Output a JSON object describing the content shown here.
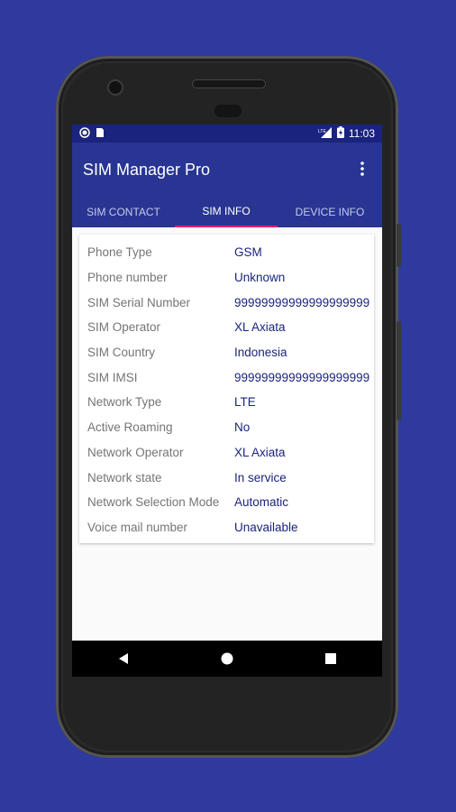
{
  "status_bar": {
    "time": "11:03",
    "left_icons": [
      "record-icon",
      "sim-card-icon"
    ],
    "right_icons": [
      "lte-signal-icon",
      "battery-icon"
    ]
  },
  "app_bar": {
    "title": "SIM Manager Pro",
    "menu_icon": "more-vert-icon"
  },
  "tabs": [
    {
      "label": "SIM CONTACT",
      "active": false
    },
    {
      "label": "SIM INFO",
      "active": true
    },
    {
      "label": "DEVICE INFO",
      "active": false
    }
  ],
  "sim_info": [
    {
      "label": "Phone Type",
      "value": "GSM"
    },
    {
      "label": "Phone number",
      "value": "Unknown"
    },
    {
      "label": "SIM Serial Number",
      "value": "99999999999999999999"
    },
    {
      "label": "SIM Operator",
      "value": "XL Axiata"
    },
    {
      "label": "SIM Country",
      "value": "Indonesia"
    },
    {
      "label": "SIM IMSI",
      "value": "99999999999999999999"
    },
    {
      "label": "Network Type",
      "value": "LTE"
    },
    {
      "label": "Active Roaming",
      "value": "No"
    },
    {
      "label": "Network Operator",
      "value": "XL Axiata"
    },
    {
      "label": "Network state",
      "value": "In service"
    },
    {
      "label": "Network Selection Mode",
      "value": "Automatic"
    },
    {
      "label": "Voice mail number",
      "value": "Unavailable"
    }
  ],
  "nav_bar": {
    "icons": [
      "back-icon",
      "home-icon",
      "recents-icon"
    ]
  },
  "colors": {
    "background": "#2e3a9d",
    "primary": "#283593",
    "primary_dark": "#1a237e",
    "accent": "#e91e63",
    "value_text": "#1a237e",
    "label_text": "#757575"
  }
}
